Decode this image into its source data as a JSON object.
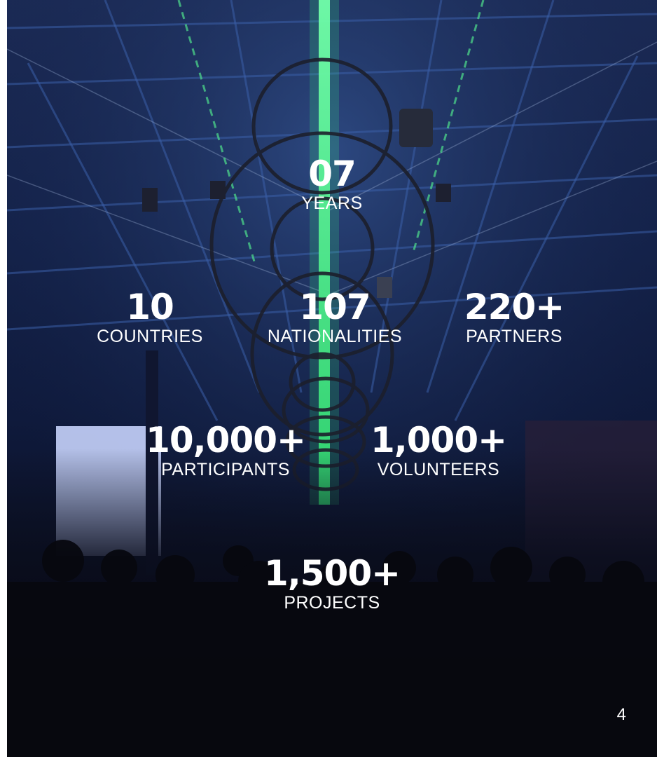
{
  "stats": {
    "years": {
      "value": "07",
      "label": "YEARS"
    },
    "countries": {
      "value": "10",
      "label": "COUNTRIES"
    },
    "nationalities": {
      "value": "107",
      "label": "NATIONALITIES"
    },
    "partners": {
      "value": "220+",
      "label": "PARTNERS"
    },
    "participants": {
      "value": "10,000+",
      "label": "PARTICIPANTS"
    },
    "volunteers": {
      "value": "1,000+",
      "label": "VOLUNTEERS"
    },
    "projects": {
      "value": "1,500+",
      "label": "PROJECTS"
    }
  },
  "page_number": "4",
  "colors": {
    "accent_green": "#38e07a",
    "text": "#ffffff"
  }
}
